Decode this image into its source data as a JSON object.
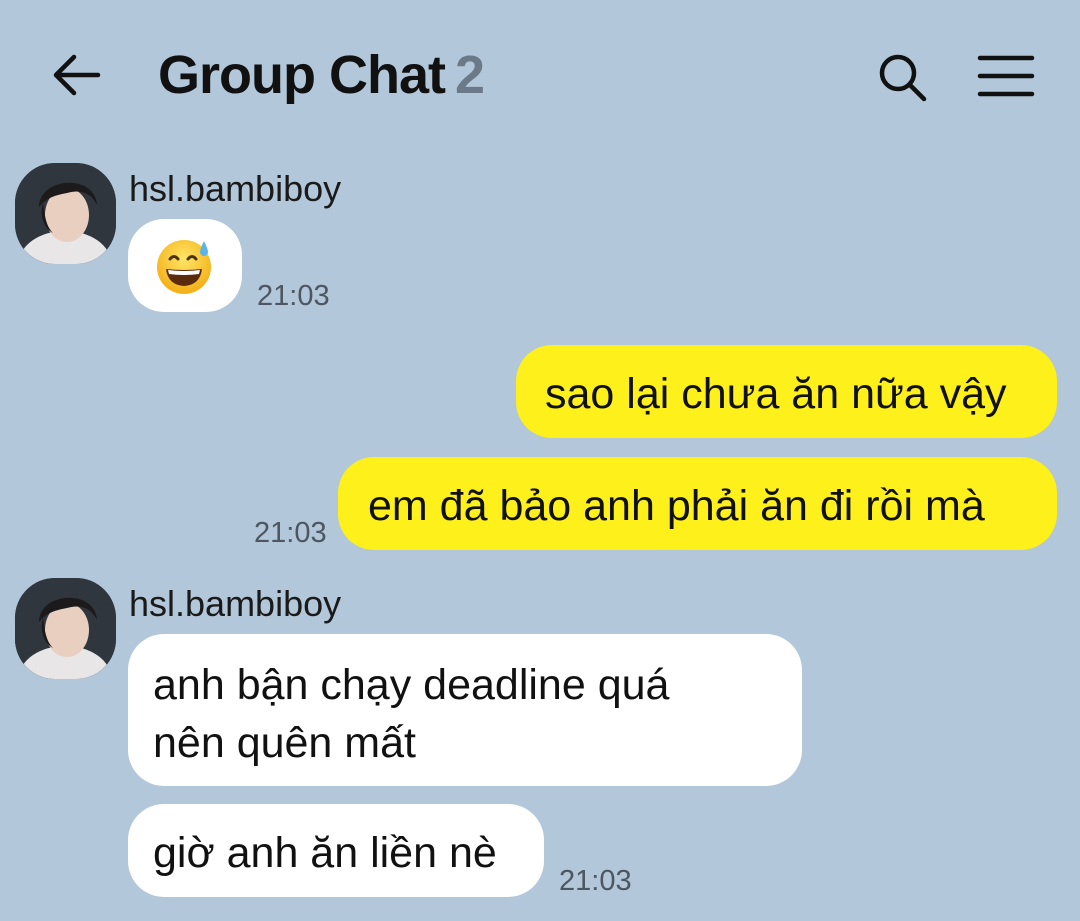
{
  "header": {
    "title": "Group Chat",
    "member_count": "2",
    "back_icon": "arrow-left-icon",
    "search_icon": "search-icon",
    "menu_icon": "menu-icon"
  },
  "messages": [
    {
      "sender": "hsl.bambiboy",
      "direction": "incoming",
      "bubbles": [
        {
          "emoji": "😅"
        }
      ],
      "time": "21:03"
    },
    {
      "direction": "outgoing",
      "bubbles": [
        {
          "text": "sao lại chưa ăn nữa vậy"
        },
        {
          "text": "em đã bảo anh phải ăn đi rồi mà"
        }
      ],
      "time": "21:03"
    },
    {
      "sender": "hsl.bambiboy",
      "direction": "incoming",
      "bubbles": [
        {
          "lines": [
            "anh bận chạy deadline quá",
            "nên quên mất"
          ]
        },
        {
          "text": "giờ anh ăn liền nè"
        }
      ],
      "time": "21:03"
    }
  ],
  "colors": {
    "background": "#b2c7d9",
    "outgoing_bubble": "#fef01b",
    "incoming_bubble": "#ffffff"
  }
}
